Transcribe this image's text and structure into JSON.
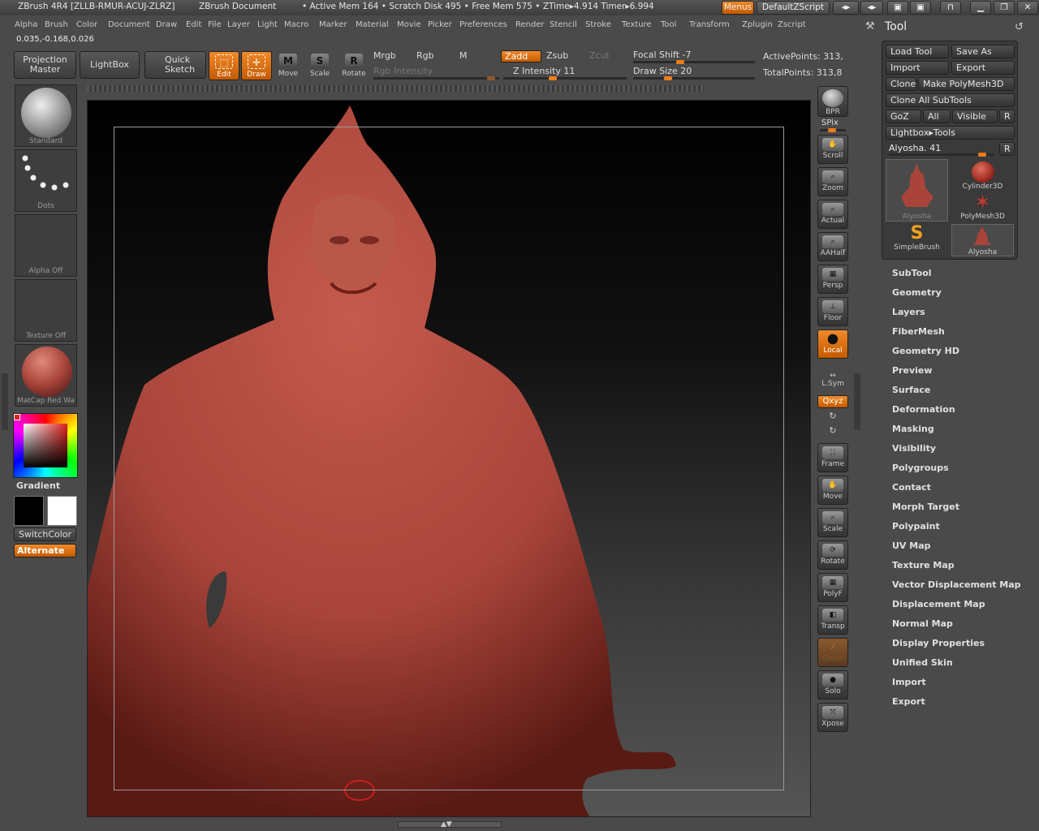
{
  "titlebar": {
    "app_title": "ZBrush 4R4 [ZLLB-RMUR-ACUJ-ZLRZ]",
    "document": "ZBrush Document",
    "stats": "• Active Mem 164 • Scratch Disk 495 • Free Mem 575 • ZTime▸4.914 Timer▸6.994",
    "menus_label": "Menus",
    "script_label": "DefaultZScript"
  },
  "menubar": [
    "Alpha",
    "Brush",
    "Color",
    "Document",
    "Draw",
    "Edit",
    "File",
    "Layer",
    "Light",
    "Macro",
    "Marker",
    "Material",
    "Movie",
    "Picker",
    "Preferences",
    "Render",
    "Stencil",
    "Stroke",
    "Texture",
    "Tool",
    "Transform",
    "Zplugin",
    "Zscript"
  ],
  "coords": "0.035,-0.168,0.026",
  "toolbar": {
    "projection_master": "Projection Master",
    "lightbox": "LightBox",
    "quick_sketch": "Quick Sketch",
    "edit": "Edit",
    "draw": "Draw",
    "move": "Move",
    "scale": "Scale",
    "rotate": "Rotate",
    "mrgb": "Mrgb",
    "rgb": "Rgb",
    "m": "M",
    "rgb_intensity": "Rgb Intensity",
    "zadd": "Zadd",
    "zsub": "Zsub",
    "zcut": "Zcut",
    "z_intensity": "Z Intensity 11",
    "z_intensity_value": 0.11,
    "focal_shift": "Focal Shift -7",
    "focal_shift_value": -7,
    "draw_size": "Draw Size 20",
    "draw_size_value": 20,
    "active_points": "ActivePoints: 313,",
    "total_points": "TotalPoints: 313,8"
  },
  "left": {
    "brush": "Standard",
    "stroke": "Dots",
    "alpha": "Alpha  Off",
    "texture": "Texture  Off",
    "material": "MatCap  Red  Wa",
    "gradient": "Gradient",
    "switch_color": "SwitchColor",
    "alternate": "Alternate"
  },
  "right_shelf": {
    "bpr": "BPR",
    "spix": "SPix",
    "scroll": "Scroll",
    "zoom": "Zoom",
    "actual": "Actual",
    "aahalf": "AAHalf",
    "persp": "Persp",
    "floor": "Floor",
    "local": "Local",
    "lsym": "L.Sym",
    "xyz": "Qxyz",
    "frame": "Frame",
    "move": "Move",
    "scale": "Scale",
    "rotate": "Rotate",
    "polyf": "PolyF",
    "transp": "Transp",
    "ghost": "Ghost",
    "solo": "Solo",
    "xpose": "Xpose"
  },
  "tool": {
    "title": "Tool",
    "load_tool": "Load Tool",
    "save_as": "Save As",
    "import": "Import",
    "export": "Export",
    "clone": "Clone",
    "make_polymesh": "Make PolyMesh3D",
    "clone_all": "Clone  All  SubTools",
    "goz": "GoZ",
    "all": "All",
    "visible": "Visible",
    "r": "R",
    "lightbox_tools": "Lightbox▸Tools",
    "current_tool": "Alyosha. 41",
    "current_tool_value": 41,
    "thumbs": [
      "Alyosha",
      "Cylinder3D",
      "PolyMesh3D",
      "SimpleBrush",
      "Alyosha"
    ]
  },
  "sections": [
    "SubTool",
    "Geometry",
    "Layers",
    "FiberMesh",
    "Geometry HD",
    "Preview",
    "Surface",
    "Deformation",
    "Masking",
    "Visibility",
    "Polygroups",
    "Contact",
    "Morph Target",
    "Polypaint",
    "UV Map",
    "Texture Map",
    "Vector Displacement Map",
    "Displacement Map",
    "Normal Map",
    "Display Properties",
    "Unified Skin",
    "Import",
    "Export"
  ],
  "colors": {
    "accent": "#ef7d1a",
    "model": "#a8443a",
    "bg": "#4a4a4a"
  }
}
